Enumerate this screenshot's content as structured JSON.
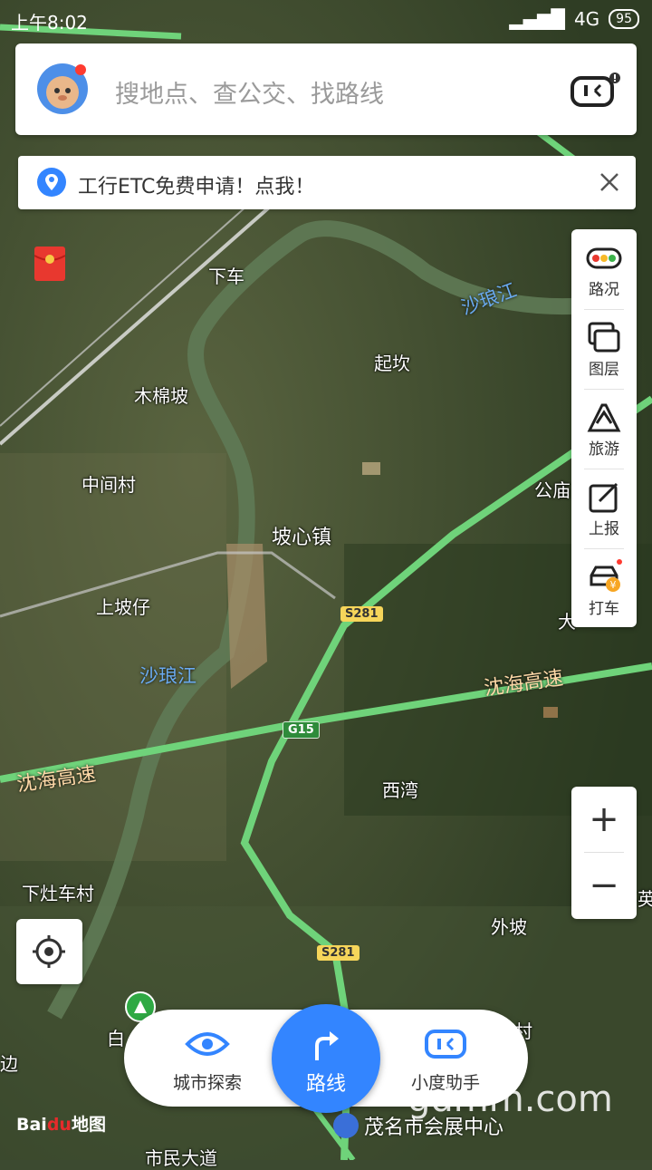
{
  "status": {
    "time": "上午8:02",
    "network": "4G",
    "battery": "95"
  },
  "search": {
    "placeholder": "搜地点、查公交、找路线"
  },
  "banner": {
    "text": "工行ETC免费申请！点我！"
  },
  "side_panel": [
    {
      "label": "路况",
      "icon": "traffic-icon"
    },
    {
      "label": "图层",
      "icon": "layers-icon"
    },
    {
      "label": "旅游",
      "icon": "travel-icon"
    },
    {
      "label": "上报",
      "icon": "report-icon"
    },
    {
      "label": "打车",
      "icon": "taxi-icon"
    }
  ],
  "zoom": {
    "in": "+",
    "out": "−"
  },
  "bottom": {
    "explore": "城市探索",
    "route": "路线",
    "assistant": "小度助手"
  },
  "logo": {
    "bai": "Bai",
    "du": "du",
    "map": "地图"
  },
  "poi": "茂名市会展中心",
  "watermark": "gdmm.com",
  "map_labels": {
    "xiache": "下车",
    "qikan": "起坎",
    "mumianpo": "木棉坡",
    "zhongjiancun": "中间村",
    "poxinzhen": "坡心镇",
    "shangpozai": "上坡仔",
    "xiwan": "西湾",
    "xiazaochecun": "下灶车村",
    "waipo": "外坡",
    "gongmiao": "公庙",
    "shalangjiang1": "沙琅江",
    "shalangjiang2": "沙琅江",
    "shenhai1": "沈海高速",
    "shenhai2": "沈海高速",
    "s281a": "S281",
    "s281b": "S281",
    "g15": "G15",
    "shijidadao": "市民大道",
    "bai": "白",
    "cun": "村",
    "bian": "边",
    "ying": "英",
    "da": "大"
  },
  "colors": {
    "accent": "#3385ff",
    "road": "#6fd37a"
  }
}
